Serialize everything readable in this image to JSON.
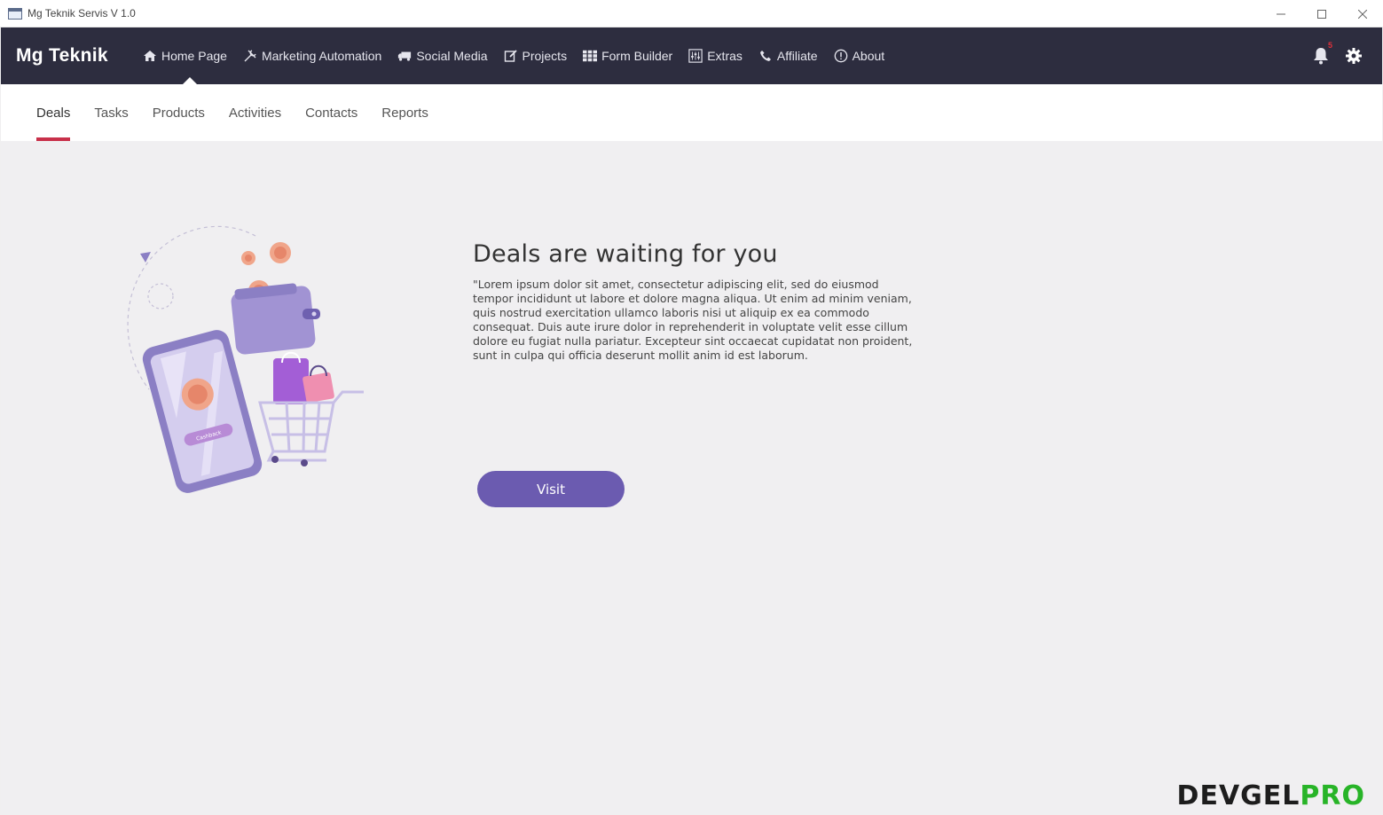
{
  "window": {
    "title": "Mg Teknik Servis V 1.0"
  },
  "navbar": {
    "brand": "Mg Teknik",
    "items": [
      {
        "label": "Home Page",
        "icon": "home-icon"
      },
      {
        "label": "Marketing Automation",
        "icon": "tools-icon"
      },
      {
        "label": "Social Media",
        "icon": "truck-icon"
      },
      {
        "label": "Projects",
        "icon": "edit-icon"
      },
      {
        "label": "Form Builder",
        "icon": "grid-icon"
      },
      {
        "label": "Extras",
        "icon": "sliders-icon"
      },
      {
        "label": "Affiliate",
        "icon": "phone-icon"
      },
      {
        "label": "About",
        "icon": "info-icon"
      }
    ],
    "notification_count": "5"
  },
  "subtabs": [
    "Deals",
    "Tasks",
    "Products",
    "Activities",
    "Contacts",
    "Reports"
  ],
  "main": {
    "heading": "Deals are waiting for you",
    "description": "\"Lorem ipsum dolor sit amet, consectetur adipiscing elit, sed do eiusmod tempor incididunt ut labore et dolore magna aliqua. Ut enim ad minim veniam, quis nostrud exercitation ullamco laboris nisi ut aliquip ex ea commodo consequat. Duis aute irure dolor in reprehenderit in voluptate velit esse cillum dolore eu fugiat nulla pariatur. Excepteur sint occaecat cupidatat non proident, sunt in culpa qui officia deserunt mollit anim id est laborum.",
    "visit_label": "Visit",
    "illustration_button": "Cashback"
  },
  "watermark": {
    "prefix": "DEVGEL",
    "suffix": "PRO"
  },
  "colors": {
    "navbar": "#2d2d3f",
    "accent": "#6b5bb0",
    "tab_underline": "#c8304a"
  }
}
